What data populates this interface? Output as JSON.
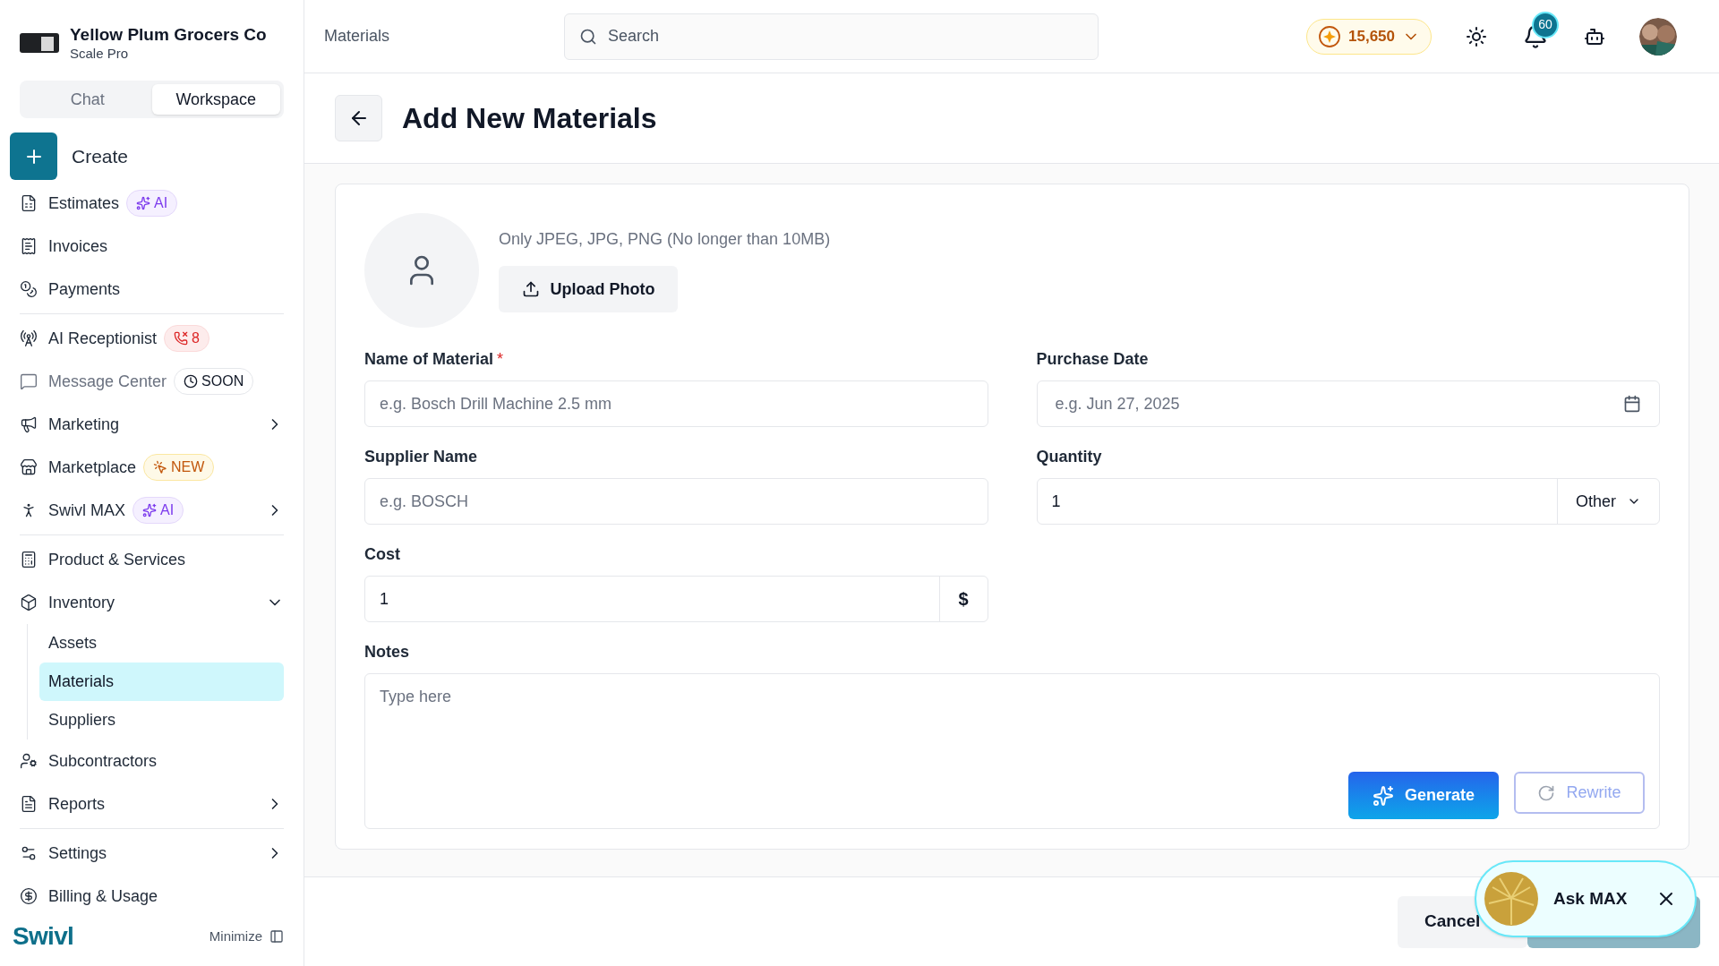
{
  "company": {
    "name": "Yellow Plum Grocers Co",
    "plan": "Scale Pro"
  },
  "mode_tabs": [
    {
      "label": "Chat",
      "selected": false
    },
    {
      "label": "Workspace",
      "selected": true
    }
  ],
  "create_button": "Create",
  "nav_groups": [
    [
      {
        "label": "Estimates",
        "disabled": false,
        "badge": {
          "kind": "ai",
          "text": "AI"
        }
      },
      {
        "label": "Invoices",
        "disabled": false
      },
      {
        "label": "Payments",
        "disabled": false
      }
    ],
    [
      {
        "label": "AI Receptionist",
        "disabled": false,
        "badge": {
          "kind": "missed",
          "text": "8"
        }
      },
      {
        "label": "Message Center",
        "disabled": true,
        "badge": {
          "kind": "soon",
          "text": "SOON"
        }
      },
      {
        "label": "Marketing",
        "disabled": false,
        "expanded": false
      },
      {
        "label": "Marketplace",
        "disabled": false,
        "badge": {
          "kind": "new",
          "text": "NEW"
        }
      },
      {
        "label": "Swivl MAX",
        "disabled": false,
        "badge": {
          "kind": "ai",
          "text": "AI"
        },
        "expanded": false
      }
    ],
    [
      {
        "label": "Product & Services",
        "disabled": false
      },
      {
        "label": "Inventory",
        "disabled": false,
        "expanded": true,
        "children": [
          {
            "label": "Assets",
            "selected": false
          },
          {
            "label": "Materials",
            "selected": true
          },
          {
            "label": "Suppliers",
            "selected": false
          }
        ]
      },
      {
        "label": "Subcontractors",
        "disabled": false
      },
      {
        "label": "Reports",
        "disabled": false,
        "expanded": false
      }
    ],
    [
      {
        "label": "Settings",
        "disabled": false,
        "expanded": false
      },
      {
        "label": "Billing & Usage",
        "disabled": false
      }
    ]
  ],
  "brand": "Swivl",
  "minimize": "Minimize",
  "header": {
    "breadcrumb": "Materials",
    "search_placeholder": "Search",
    "credits": "15,650",
    "notifications": "60"
  },
  "page": {
    "title": "Add New Materials",
    "photo": {
      "hint": "Only JPEG, JPG, PNG (No longer than 10MB)",
      "upload_button": "Upload Photo"
    },
    "fields": [
      {
        "kind": "text",
        "label": "Name of Material",
        "required_mark": "*",
        "placeholder": "e.g. Bosch Drill Machine 2.5 mm"
      },
      {
        "kind": "date",
        "label": "Purchase Date",
        "placeholder": "e.g. Jun 27, 2025"
      },
      {
        "kind": "text",
        "label": "Supplier Name",
        "placeholder": "e.g. BOSCH"
      },
      {
        "kind": "quantity",
        "label": "Quantity",
        "value": "1",
        "unit": "Other"
      },
      {
        "kind": "cost",
        "label": "Cost",
        "value": "1",
        "currency": "$"
      }
    ],
    "notes": {
      "label": "Notes",
      "placeholder": "Type here",
      "generate_button": "Generate",
      "rewrite_button": {
        "label": "Rewrite",
        "disabled": true
      }
    }
  },
  "footer": {
    "cancel_button": "Cancel"
  },
  "ask_max": {
    "label": "Ask MAX"
  }
}
